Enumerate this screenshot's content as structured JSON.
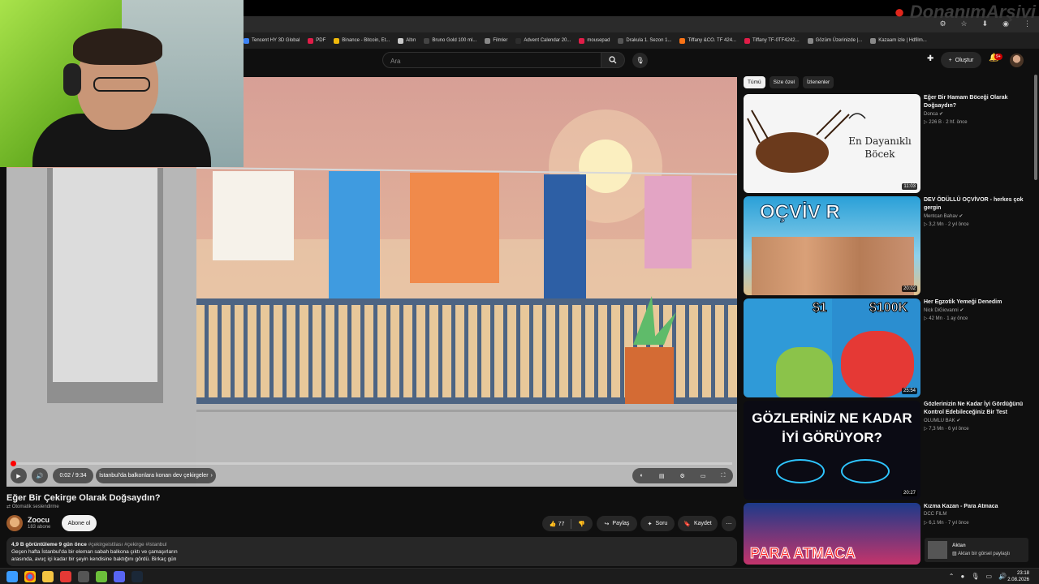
{
  "browser": {
    "bookmarks": [
      {
        "label": "Tencent HY 3D Global",
        "color": "#3b82f6"
      },
      {
        "label": "PDF",
        "color": "#e11d48"
      },
      {
        "label": "Binance - Bitcoin, Et...",
        "color": "#f0b90b"
      },
      {
        "label": "Altın",
        "color": "#c9c9c9"
      },
      {
        "label": "Bruno Gold 100 ml...",
        "color": "#444444"
      },
      {
        "label": "Filmler",
        "color": "#888888"
      },
      {
        "label": "Advent Calendar 20...",
        "color": "#2d2d2d"
      },
      {
        "label": "mousepad",
        "color": "#e11d48"
      },
      {
        "label": "Drakula 1. Sezon 1...",
        "color": "#555555"
      },
      {
        "label": "Tiffany &CO. TF 424...",
        "color": "#f97316"
      },
      {
        "label": "Tiffany TF-0TF4242...",
        "color": "#e11d48"
      },
      {
        "label": "Gözüm Üzerinizde |...",
        "color": "#888888"
      },
      {
        "label": "Kazaam izle | Hdfilm...",
        "color": "#888888"
      }
    ],
    "brand_logo": "DonanımArşivi"
  },
  "header": {
    "search_placeholder": "Ara",
    "create_label": "Oluştur",
    "notification_count": "9+"
  },
  "player": {
    "time": "0:02 / 9:34",
    "chapter": "İstanbul'da balkonlara konan dev çekirgeler",
    "progress_fraction": 0.0035
  },
  "video": {
    "title": "Eğer Bir Çekirge Olarak Doğsaydın?",
    "auto_dub": "Otomatik seslendirme",
    "channel": "Zoocu",
    "subscribers": "183 abone",
    "subscribe_label": "Abone ol",
    "like_count": "77",
    "share_label": "Paylaş",
    "ask_label": "Soru",
    "save_label": "Kaydet",
    "views": "4,9 B görüntüleme",
    "age": "9 gün önce",
    "tags": "#çekirgeistilası #çekirge #istanbul",
    "description_line1": "Geçen hafta İstanbul'da bir eleman sabah balkona çıktı ve çamaşırların",
    "description_line2": "arasında, avuç içi kadar bir şeyin kendisine baktığını gördü. Birkaç gün"
  },
  "chips": [
    "Tümü",
    "Size özel",
    "İzlenenler"
  ],
  "recommendations": [
    {
      "title": "Eğer Bir Hamam Böceği Olarak Doğsaydın?",
      "channel": "Donca",
      "meta": "226 B · 2 hf. önce",
      "duration": "11:03",
      "thumb_text": "En Dayanıklı Böcek"
    },
    {
      "title": "DEV ÖDÜLLÜ OÇVİVOR - herkes çok gergin",
      "channel": "Mentcan Bahav",
      "meta": "3,2 Mn · 2 yıl önce",
      "duration": "20:02",
      "thumb_text": "OÇVİV R"
    },
    {
      "title": "Her Egzotik Yemeği Denedim",
      "channel": "Nick DiGiovanni",
      "meta": "42 Mn · 1 ay önce",
      "duration": "25:54",
      "thumb_text_left": "$1",
      "thumb_text_right": "$100K"
    },
    {
      "title": "Gözlerinizin Ne Kadar İyi Gördüğünü Kontrol Edebileceğiniz Bir Test",
      "channel": "OLUMLU BAK",
      "meta": "7,3 Mn · 6 yıl önce",
      "duration": "20:27",
      "thumb_text": "GÖZLERİNİZ NE KADAR İYİ GÖRÜYOR?"
    },
    {
      "title": "Kızma Kazan - Para Atmaca",
      "channel": "DCC FILM",
      "meta": "6,1 Mn · 7 yıl önce",
      "duration": "",
      "thumb_text": "PARA ATMACA"
    }
  ],
  "toast": {
    "title": "Aktan",
    "body": "Aktan bir görsel paylaştı"
  },
  "clock": {
    "time": "23:18",
    "date": "2.08.2026"
  }
}
